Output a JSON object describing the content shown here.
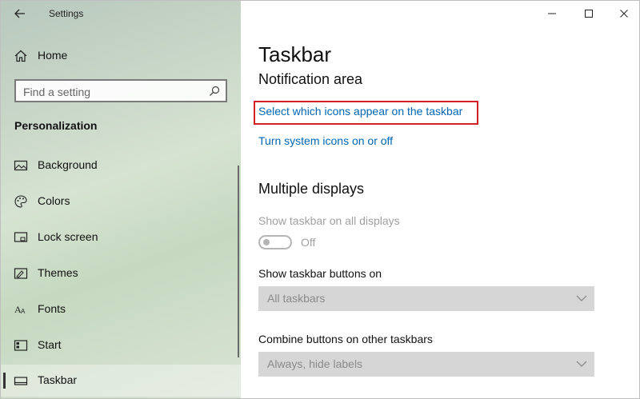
{
  "window": {
    "app_title": "Settings",
    "icons": [
      "back-arrow-icon",
      "minimize-icon",
      "maximize-icon",
      "close-icon"
    ]
  },
  "sidebar": {
    "home_label": "Home",
    "search_placeholder": "Find a setting",
    "section_title": "Personalization",
    "items": [
      {
        "label": "Background",
        "icon": "background-picture-icon"
      },
      {
        "label": "Colors",
        "icon": "palette-icon"
      },
      {
        "label": "Lock screen",
        "icon": "lock-screen-icon"
      },
      {
        "label": "Themes",
        "icon": "themes-brush-icon"
      },
      {
        "label": "Fonts",
        "icon": "fonts-icon"
      },
      {
        "label": "Start",
        "icon": "start-menu-icon"
      },
      {
        "label": "Taskbar",
        "icon": "taskbar-icon",
        "selected": true
      }
    ]
  },
  "main": {
    "page_title": "Taskbar",
    "notification_area": {
      "heading": "Notification area",
      "link_icons": "Select which icons appear on the taskbar",
      "link_system_icons": "Turn system icons on or off"
    },
    "multiple_displays": {
      "heading": "Multiple displays",
      "show_on_all_label": "Show taskbar on all displays",
      "show_on_all_state": "Off",
      "buttons_on_label": "Show taskbar buttons on",
      "buttons_on_value": "All taskbars",
      "combine_label": "Combine buttons on other taskbars",
      "combine_value": "Always, hide labels"
    }
  },
  "colors": {
    "link": "#0066b4",
    "highlight_box": "#d31f26",
    "disabled_text": "#a0a0a0"
  }
}
